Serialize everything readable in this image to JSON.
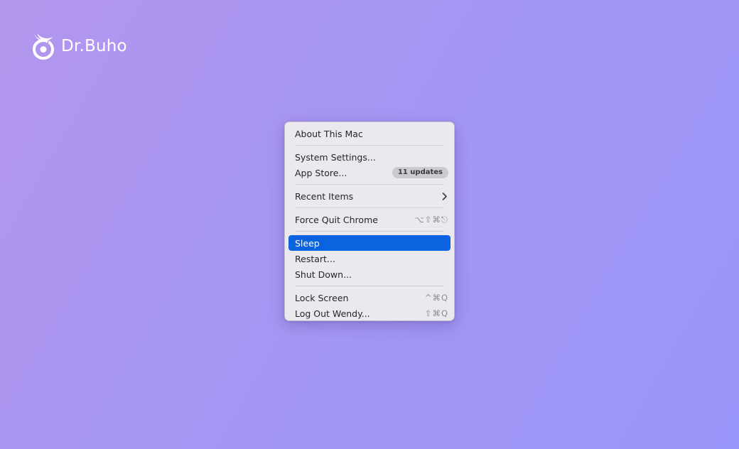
{
  "brand": {
    "name": "Dr.Buho",
    "logo_icon": "owl-swirl-icon"
  },
  "menu": {
    "about": "About This Mac",
    "system_settings": "System Settings...",
    "app_store": "App Store...",
    "app_store_badge": "11 updates",
    "recent_items": "Recent Items",
    "recent_items_icon": "chevron-right-icon",
    "force_quit": "Force Quit Chrome",
    "force_quit_shortcut": "⌥⇧⌘⎋",
    "sleep": "Sleep",
    "restart": "Restart...",
    "shut_down": "Shut Down...",
    "lock_screen": "Lock Screen",
    "lock_screen_shortcut": "^⌘Q",
    "log_out": "Log Out Wendy...",
    "log_out_shortcut": "⇧⌘Q",
    "selected_item": "Sleep"
  },
  "colors": {
    "background_start": "#b396ee",
    "background_end": "#9a95f8",
    "selection": "#0a64e0",
    "menu_background": "#ebe8ee"
  }
}
